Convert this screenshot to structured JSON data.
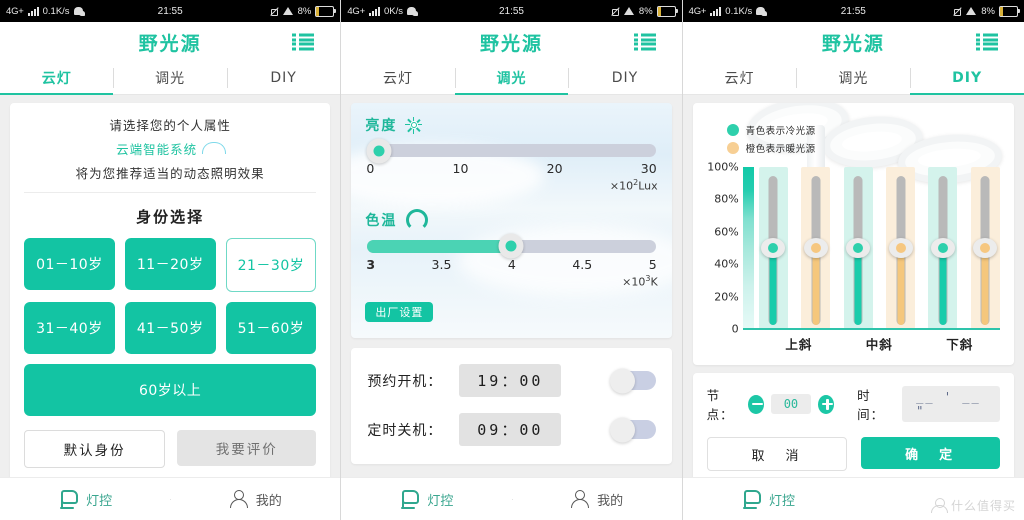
{
  "app": {
    "title": "野光源",
    "accent": "#13c4a3",
    "cool_color": "#19ccab",
    "warm_color": "#f5c77c"
  },
  "statusbars": [
    {
      "network": "4G+",
      "speed": "0.1K/s",
      "time": "21:55",
      "battery": "8%"
    },
    {
      "network": "4G+",
      "speed": "0K/s",
      "time": "21:55",
      "battery": "8%"
    },
    {
      "network": "4G+",
      "speed": "0.1K/s",
      "time": "21:55",
      "battery": "8%"
    }
  ],
  "tabs": [
    "云灯",
    "调光",
    "DIY"
  ],
  "active_tabs": [
    0,
    1,
    2
  ],
  "panel1": {
    "intro_line1": "请选择您的个人属性",
    "intro_line2": "云端智能系统",
    "intro_line3": "将为您推荐适当的动态照明效果",
    "section_title": "身份选择",
    "age_buttons": [
      {
        "label": "01－10岁",
        "selected": false
      },
      {
        "label": "11－20岁",
        "selected": false
      },
      {
        "label": "21－30岁",
        "selected": true
      },
      {
        "label": "31－40岁",
        "selected": false
      },
      {
        "label": "41－50岁",
        "selected": false
      },
      {
        "label": "51－60岁",
        "selected": false
      }
    ],
    "wide_button": "60岁以上",
    "default_identity": "默认身份",
    "review": "我要评价"
  },
  "panel2": {
    "brightness": {
      "label": "亮度",
      "value": 0,
      "ticks": [
        "0",
        "10",
        "20",
        "30"
      ],
      "unit_prefix": "×10",
      "unit_sup": "2",
      "unit_suffix": "Lux"
    },
    "colortemp": {
      "label": "色温",
      "value": 4,
      "ticks": [
        "3",
        "3.5",
        "4",
        "4.5",
        "5"
      ],
      "unit_prefix": "×10",
      "unit_sup": "3",
      "unit_suffix": "K"
    },
    "factory_reset": "出厂设置",
    "timers": [
      {
        "label": "预约开机：",
        "value": "19：00",
        "on": false
      },
      {
        "label": "定时关机：",
        "value": "09：00",
        "on": false
      }
    ]
  },
  "panel3": {
    "legend": [
      {
        "text": "青色表示冷光源",
        "color": "#2ed0ac"
      },
      {
        "text": "橙色表示暖光源",
        "color": "#f7cf94"
      }
    ],
    "node_label": "节点：",
    "node_value": "00",
    "time_label": "时间：",
    "time_value": "__ ' __ \"",
    "cancel": "取　消",
    "confirm": "确　定"
  },
  "bottomnav": [
    {
      "label": "灯控",
      "icon": "lamp-icon",
      "active": true
    },
    {
      "label": "我的",
      "icon": "user-icon",
      "active": false
    },
    {
      "label": "灯控",
      "icon": "lamp-icon",
      "active": true
    },
    {
      "label": "我的",
      "icon": "user-icon",
      "active": false
    },
    {
      "label": "灯控",
      "icon": "lamp-icon",
      "active": true
    }
  ],
  "watermark": "什么值得买",
  "chart_data": {
    "type": "bar",
    "title": "",
    "xlabel": "",
    "ylabel": "",
    "categories": [
      "上斜",
      "中斜",
      "下斜"
    ],
    "ytick_labels": [
      "100%",
      "80%",
      "60%",
      "40%",
      "20%",
      "0"
    ],
    "ylim": [
      0,
      100
    ],
    "grid": false,
    "legend_position": "top-left",
    "series": [
      {
        "name": "青色表示冷光源",
        "color": "#19ccab",
        "values": [
          50,
          50,
          50
        ]
      },
      {
        "name": "橙色表示暖光源",
        "color": "#f5c77c",
        "values": [
          50,
          50,
          50
        ]
      }
    ]
  }
}
